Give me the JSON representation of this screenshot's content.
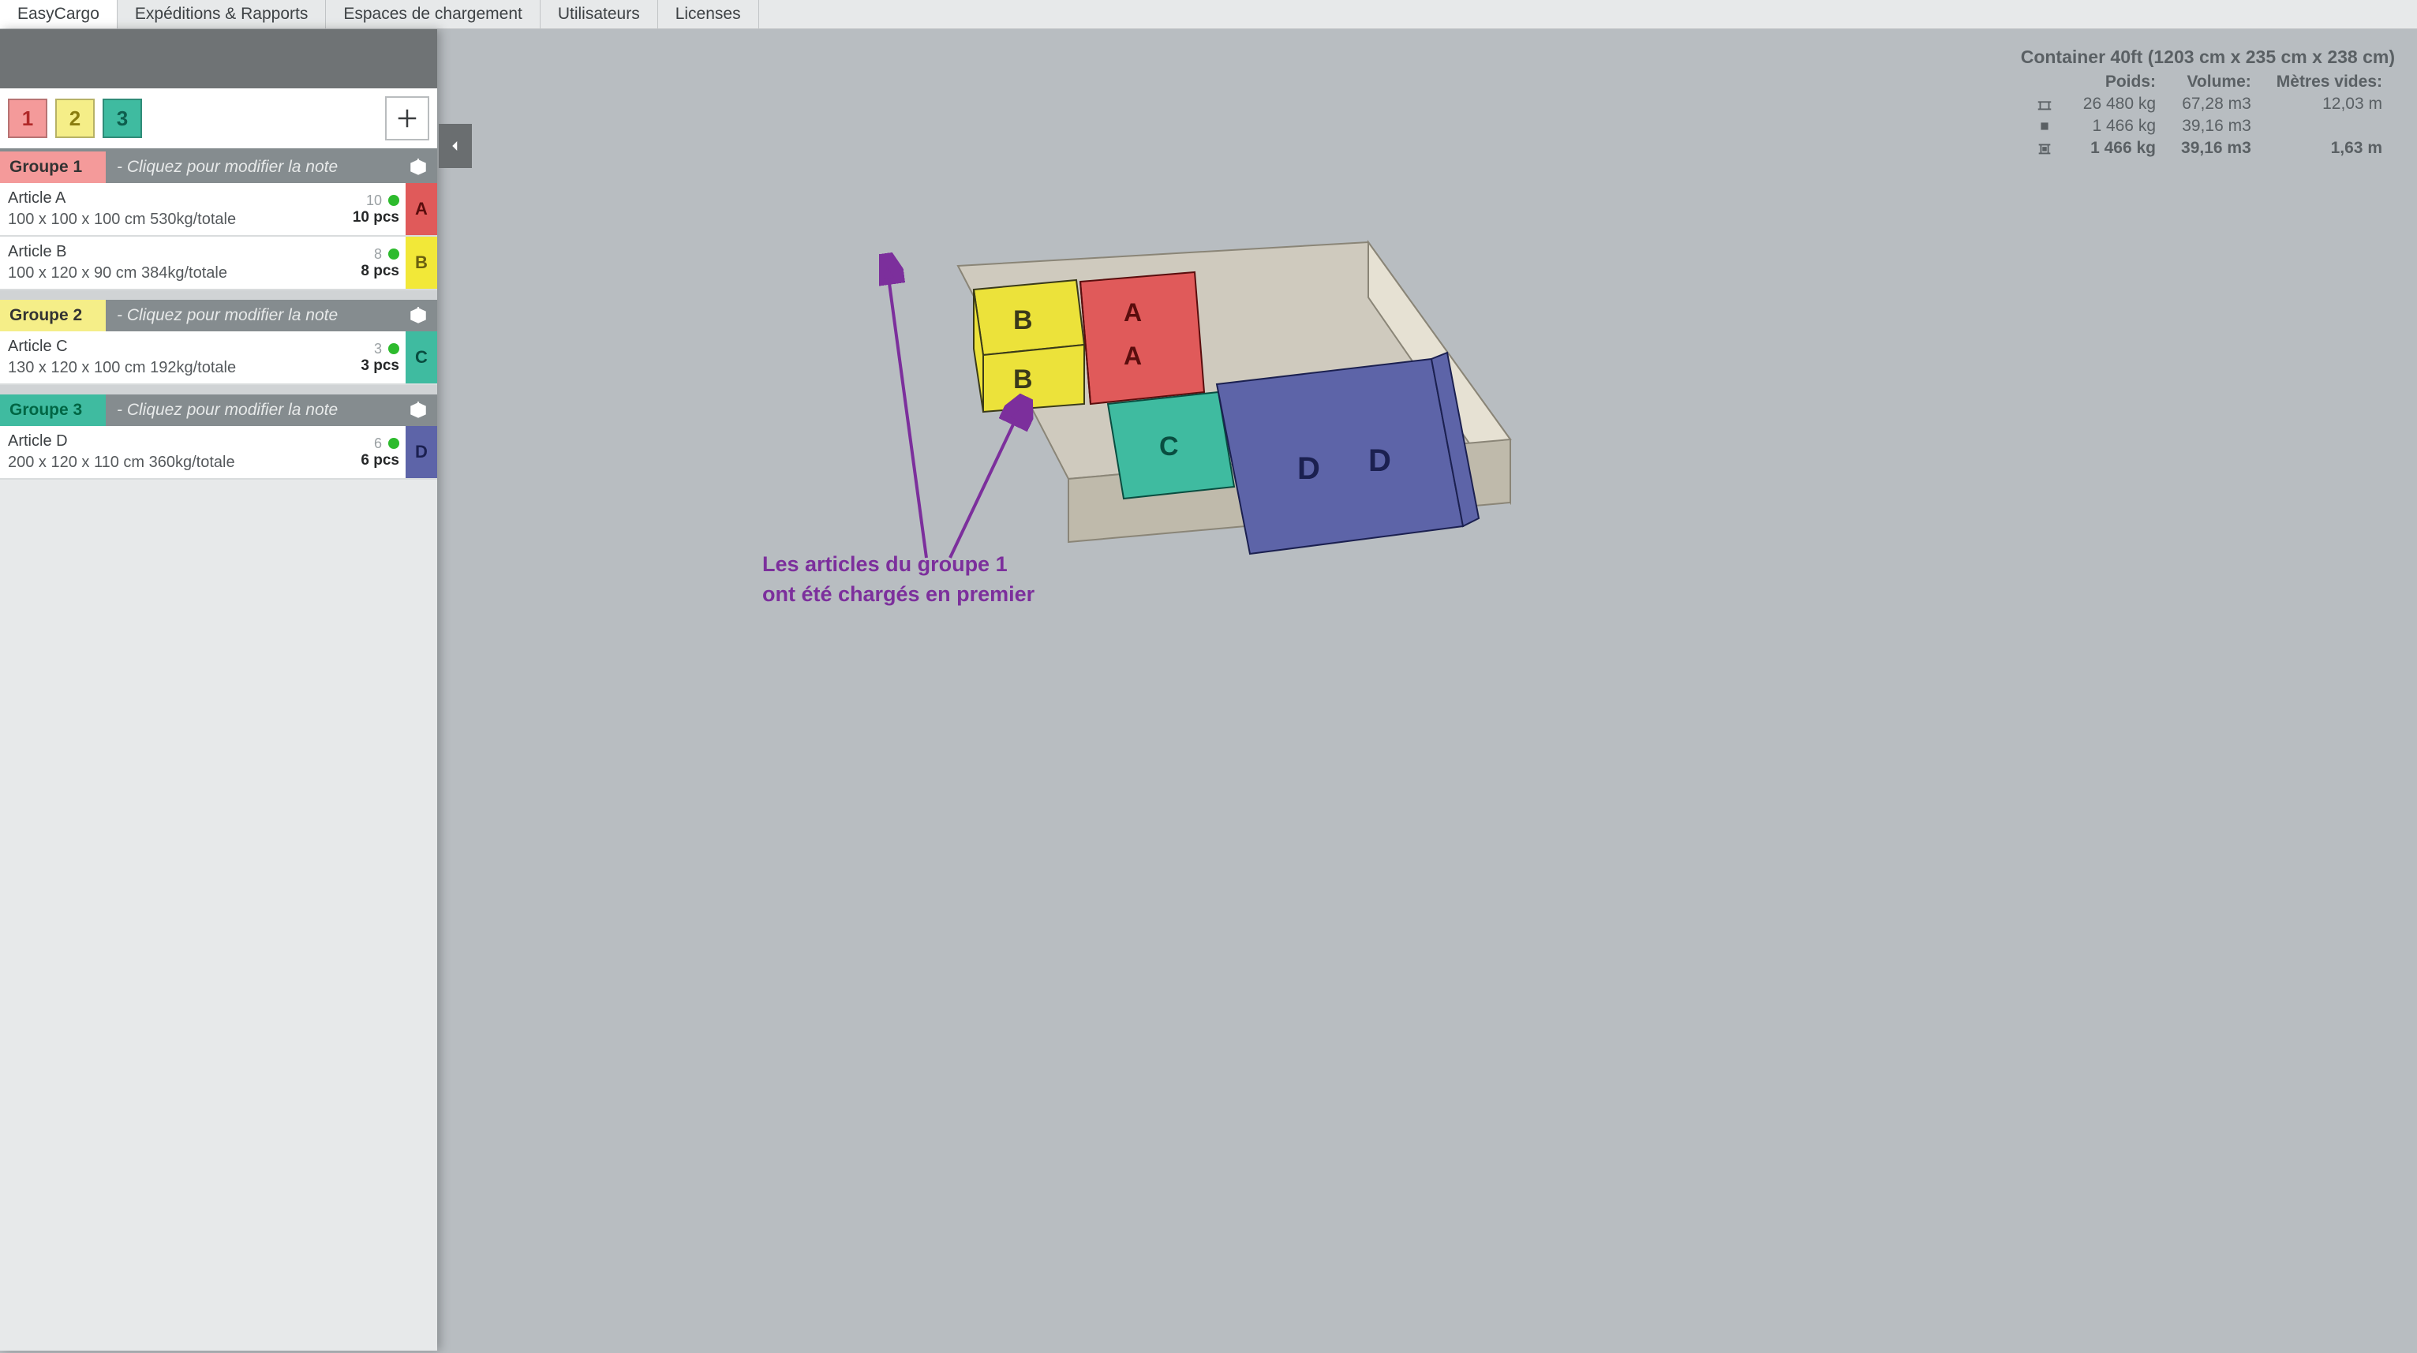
{
  "nav": {
    "app": "EasyCargo",
    "tabs": [
      "Expéditions & Rapports",
      "Espaces de chargement",
      "Utilisateurs",
      "Licenses"
    ]
  },
  "priority_tabs": [
    "1",
    "2",
    "3"
  ],
  "groups": [
    {
      "label": "Groupe 1",
      "color_class": "c1",
      "note_placeholder": "- Cliquez pour modifier la note",
      "items": [
        {
          "name": "Article A",
          "dims": "100 x 100 x 100 cm 530kg/totale",
          "count": "10",
          "pcs": "10 pcs",
          "letter": "A",
          "letter_class": "ic-a"
        },
        {
          "name": "Article B",
          "dims": "100 x 120 x 90 cm 384kg/totale",
          "count": "8",
          "pcs": "8 pcs",
          "letter": "B",
          "letter_class": "ic-b"
        }
      ]
    },
    {
      "label": "Groupe 2",
      "color_class": "c2",
      "note_placeholder": "- Cliquez pour modifier la note",
      "items": [
        {
          "name": "Article C",
          "dims": "130 x 120 x 100 cm 192kg/totale",
          "count": "3",
          "pcs": "3 pcs",
          "letter": "C",
          "letter_class": "ic-c"
        }
      ]
    },
    {
      "label": "Groupe 3",
      "color_class": "c3",
      "note_placeholder": "- Cliquez pour modifier la note",
      "items": [
        {
          "name": "Article D",
          "dims": "200 x 120 x 110 cm 360kg/totale",
          "count": "6",
          "pcs": "6 pcs",
          "letter": "D",
          "letter_class": "ic-d"
        }
      ]
    }
  ],
  "container": {
    "title": "Container 40ft (1203 cm x 235 cm x 238 cm)",
    "headers": {
      "weight": "Poids:",
      "volume": "Volume:",
      "empty": "Mètres vides:"
    },
    "rows": [
      {
        "icon": "container",
        "weight": "26 480 kg",
        "volume": "67,28 m3",
        "empty": "12,03 m"
      },
      {
        "icon": "cargo",
        "weight": "1 466 kg",
        "volume": "39,16 m3",
        "empty": ""
      },
      {
        "icon": "loaded",
        "weight": "1 466 kg",
        "volume": "39,16 m3",
        "empty": "1,63 m",
        "bold": true
      }
    ]
  },
  "annotation": {
    "line1": "Les articles du groupe 1",
    "line2": "ont été chargés en premier"
  }
}
